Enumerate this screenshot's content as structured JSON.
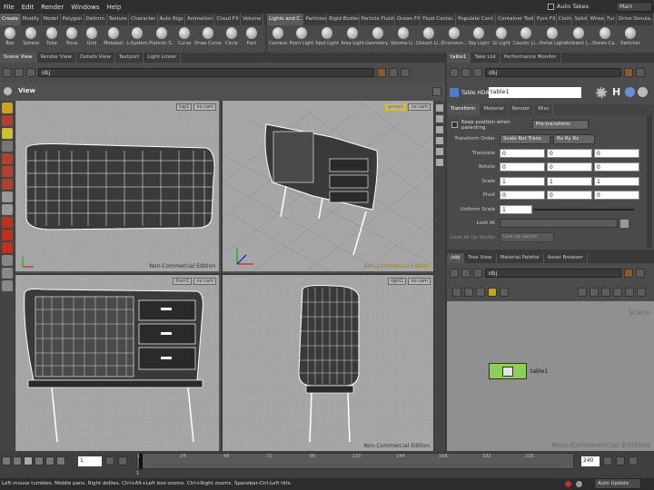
{
  "menu": [
    "File",
    "Edit",
    "Render",
    "Windows",
    "Help"
  ],
  "auto_takes": "Auto Takes",
  "desktop": "Main",
  "shelf_tabs_left": [
    "Create",
    "Modify",
    "Model",
    "Polygon",
    "Deform",
    "Texture",
    "Character",
    "Auto Rigs",
    "Animation",
    "Cloud FX",
    "Volume"
  ],
  "shelf_tools_left": [
    "Box",
    "Sphere",
    "Tube",
    "Torus",
    "Grid",
    "Metaball",
    "L-System",
    "Platonic S...",
    "Curve",
    "Draw Curve",
    "Circle",
    "Font"
  ],
  "shelf_tabs_right": [
    "Lights and C...",
    "Particles",
    "Rigid Bodies",
    "Particle Fluids",
    "Ocean FX",
    "Fluid Contai...",
    "Populate Cont...",
    "Container Tools",
    "Pyro FX",
    "Cloth",
    "Solid",
    "Wires",
    "Fur",
    "Drive Simula..."
  ],
  "shelf_tools_right": [
    "Camera",
    "Point Light",
    "Spot Light",
    "Area Light",
    "Geometry...",
    "Volume Li...",
    "Distant Li...",
    "Environm...",
    "Sky Light",
    "GI Light",
    "Caustic Li...",
    "Portal Light",
    "Ambient L...",
    "Stereo Ca...",
    "Switcher"
  ],
  "left_tabs": [
    "Scene View",
    "Render View",
    "Details View",
    "Textport",
    "Light Linker"
  ],
  "left_path": "obj",
  "view_label": "View",
  "viewports": [
    {
      "view": "top1",
      "cam": "no cam",
      "wm": "Non-Commercial Edition"
    },
    {
      "view": "persp1",
      "cam": "no cam",
      "wm": "Non-Commercial Edition"
    },
    {
      "view": "front1",
      "cam": "no cam",
      "wm": ""
    },
    {
      "view": "right1",
      "cam": "no cam",
      "wm": "Non-Commercial Edition"
    }
  ],
  "right_tabs": [
    "table1",
    "Take List",
    "Performance Monitor"
  ],
  "right_path": "obj",
  "node_type": "Table HDA",
  "node_name": "table1",
  "param_tabs": [
    "Transform",
    "Material",
    "Render",
    "Misc"
  ],
  "keep_position": "Keep position when parenting",
  "keep_value": "Pre-transform",
  "transform_order_label": "Transform Order",
  "transform_order": [
    "Scale Rot Trans",
    "Rx Ry Rz"
  ],
  "params": [
    {
      "label": "Translate",
      "v": [
        "0",
        "0",
        "0"
      ]
    },
    {
      "label": "Rotate",
      "v": [
        "0",
        "0",
        "0"
      ]
    },
    {
      "label": "Scale",
      "v": [
        "1",
        "1",
        "1"
      ]
    },
    {
      "label": "Pivot",
      "v": [
        "0",
        "0",
        "0"
      ]
    }
  ],
  "uniform_scale_label": "Uniform Scale",
  "uniform_scale": "1",
  "look_at_label": "Look At",
  "look_up_label": "Look At Up Vector",
  "look_up_value": "Use up vector",
  "network_tabs": [
    "/obj",
    "Tree View",
    "Material Palette",
    "Asset Browser"
  ],
  "network_path": "obj",
  "scene_label": "Scene",
  "node_label": "table1",
  "network_wm": "Non-Commercial Edition",
  "timeline_ticks": [
    "1",
    "24",
    "48",
    "72",
    "96",
    "120",
    "144",
    "168",
    "192",
    "216"
  ],
  "frame": "1",
  "start_frame": "1",
  "end_frame": "240",
  "auto_update": "Auto Update",
  "status_text": "Left mouse tumbles. Middle pans. Right dollies. Ctrl+Alt+Left box-zooms. Ctrl+Right zooms. Spacebar-Ctrl-Left tilts."
}
